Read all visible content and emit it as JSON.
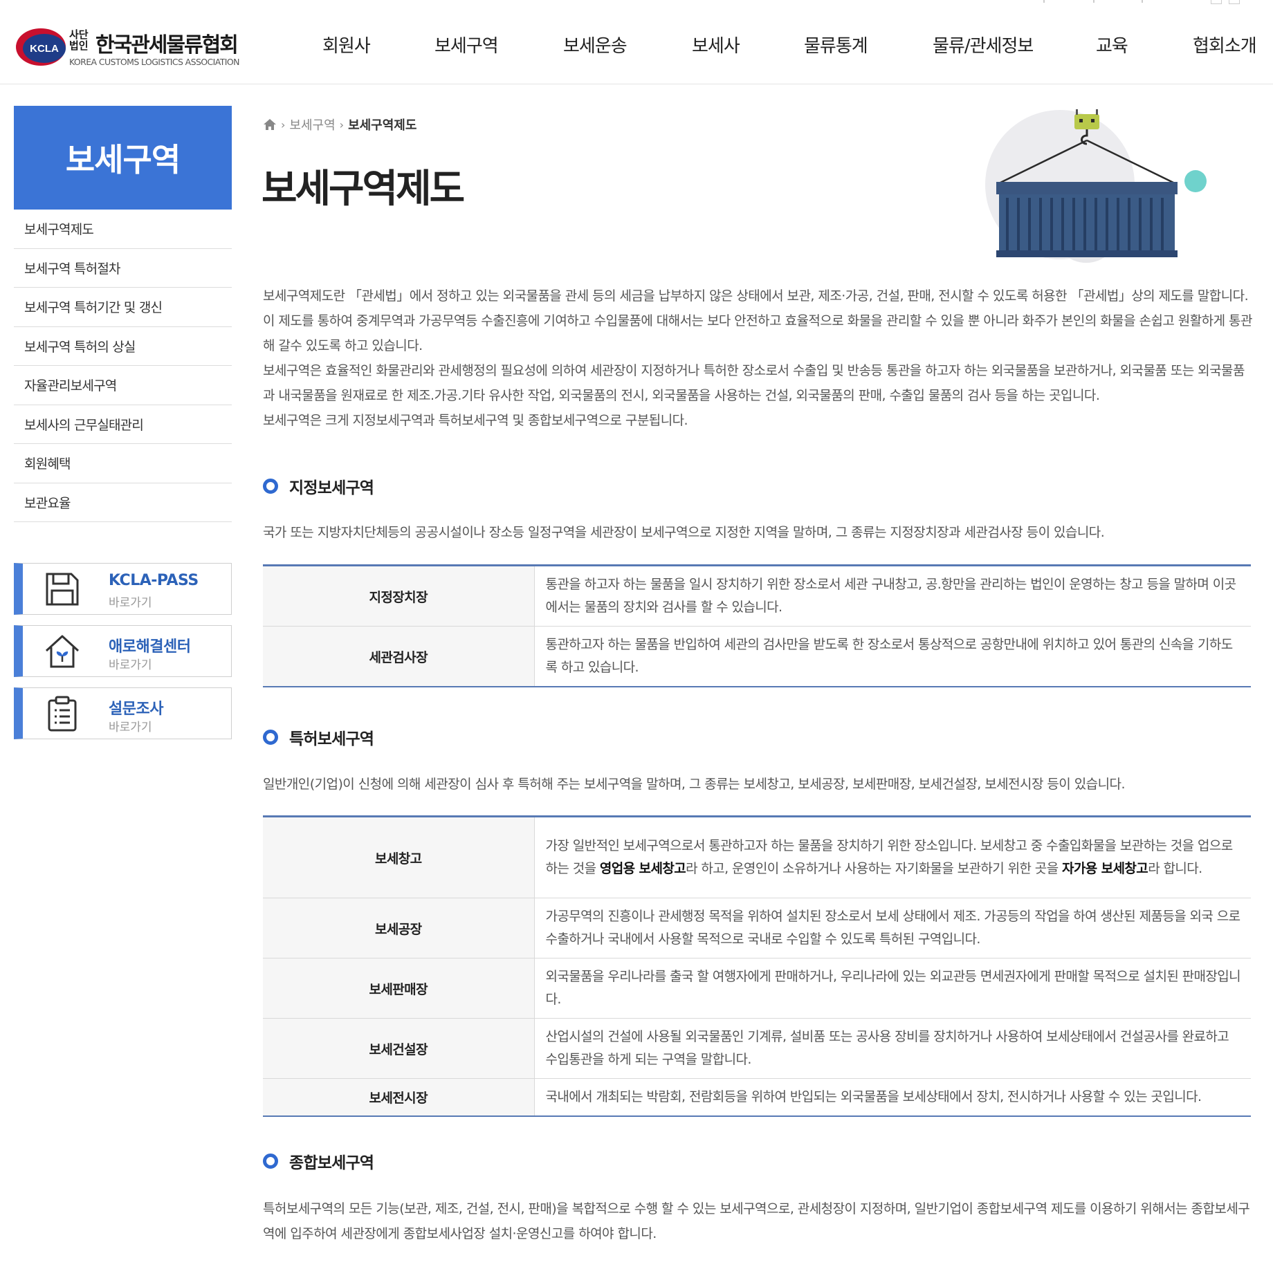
{
  "header": {
    "logo_small": "사단법인",
    "logo_name_kr": "한국관세물류협회",
    "logo_name_en": "KOREA CUSTOMS LOGISTICS ASSOCIATION",
    "logo_badge": "KCLA",
    "nav": [
      "회원사",
      "보세구역",
      "보세운송",
      "보세사",
      "물류통계",
      "물류/관세정보",
      "교육",
      "협회소개"
    ]
  },
  "sidebar": {
    "title": "보세구역",
    "items": [
      "보세구역제도",
      "보세구역 특허절차",
      "보세구역 특허기간 및 갱신",
      "보세구역 특허의 상실",
      "자율관리보세구역",
      "보세사의 근무실태관리",
      "회원혜택",
      "보관요율"
    ],
    "quick_links": [
      {
        "title": "KCLA-PASS",
        "sub": "바로가기",
        "icon": "floppy-disk-icon"
      },
      {
        "title": "애로해결센터",
        "sub": "바로가기",
        "icon": "house-sprout-icon"
      },
      {
        "title": "설문조사",
        "sub": "바로가기",
        "icon": "clipboard-icon"
      }
    ]
  },
  "breadcrumb": {
    "home_icon": "home-icon",
    "level1": "보세구역",
    "level2": "보세구역제도"
  },
  "page_title": "보세구역제도",
  "intro": [
    "보세구역제도란 「관세법」에서 정하고 있는 외국물품을 관세 등의 세금을 납부하지 않은 상태에서 보관, 제조·가공, 건설, 판매, 전시할 수 있도록 허용한 「관세법」상의 제도를 말합니다. 이 제도를 통하여 중계무역과 가공무역등 수출진흥에 기여하고 수입물품에 대해서는 보다 안전하고 효율적으로 화물을 관리할 수 있을 뿐 아니라 화주가 본인의 화물을 손쉽고 원활하게 통관해 갈수 있도록 하고 있습니다.",
    "보세구역은 효율적인 화물관리와 관세행정의 필요성에 의하여 세관장이 지정하거나 특허한 장소로서 수출입 및 반송등 통관을 하고자 하는 외국물품을 보관하거나, 외국물품 또는 외국물품과 내국물품을 원재료로 한 제조.가공.기타 유사한 작업, 외국물품의 전시, 외국물품을 사용하는 건설, 외국물품의 판매, 수출입 물품의 검사 등을 하는 곳입니다.",
    "보세구역은 크게 지정보세구역과 특허보세구역 및 종합보세구역으로 구분됩니다."
  ],
  "sections": {
    "designated": {
      "title": "지정보세구역",
      "desc": "국가 또는 지방자치단체등의 공공시설이나 장소등 일정구역을 세관장이 보세구역으로 지정한 지역을 말하며, 그 종류는 지정장치장과 세관검사장 등이 있습니다.",
      "rows": [
        {
          "name": "지정장치장",
          "text": "통관을 하고자 하는 물품을 일시 장치하기 위한 장소로서 세관 구내창고, 공.항만을 관리하는 법인이 운영하는 창고 등을 말하며 이곳에서는 물품의 장치와 검사를 할 수 있습니다."
        },
        {
          "name": "세관검사장",
          "text": "통관하고자 하는 물품을 반입하여 세관의 검사만을 받도록 한 장소로서 통상적으로 공항만내에 위치하고 있어 통관의 신속을 기하도록 하고 있습니다."
        }
      ]
    },
    "patented": {
      "title": "특허보세구역",
      "desc": "일반개인(기업)이 신청에 의해 세관장이 심사 후 특허해 주는 보세구역을 말하며, 그 종류는 보세창고, 보세공장, 보세판매장, 보세건설장, 보세전시장 등이 있습니다.",
      "warehouse": {
        "name": "보세창고",
        "text_a": "가장 일반적인 보세구역으로서 통관하고자 하는 물품을 장치하기 위한 장소입니다. 보세창고 중 수출입화물을 보관하는 것을 업으로 하는 것을 ",
        "bold_a": "영업용 보세창고",
        "text_b": "라 하고, 운영인이 소유하거나 사용하는 자기화물을 보관하기 위한 곳을 ",
        "bold_b": "자가용 보세창고",
        "text_c": "라 합니다."
      },
      "rows": [
        {
          "name": "보세공장",
          "text": "가공무역의 진흥이나 관세행정 목적을 위하여 설치된 장소로서 보세 상태에서 제조. 가공등의 작업을 하여 생산된 제품등을 외국 으로 수출하거나 국내에서 사용할 목적으로 국내로 수입할 수 있도록 특허된 구역입니다."
        },
        {
          "name": "보세판매장",
          "text": "외국물품을 우리나라를 출국 할 여행자에게 판매하거나, 우리나라에 있는 외교관등 면세권자에게 판매할 목적으로 설치된 판매장입니다."
        },
        {
          "name": "보세건설장",
          "text": "산업시설의 건설에 사용될 외국물품인 기계류, 설비품 또는 공사용 장비를 장치하거나 사용하여 보세상태에서 건설공사를 완료하고 수입통관을 하게 되는 구역을 말합니다."
        },
        {
          "name": "보세전시장",
          "text": "국내에서 개최되는 박람회, 전람회등을 위하여 반입되는 외국물품을 보세상태에서 장치, 전시하거나 사용할 수 있는 곳입니다."
        }
      ]
    },
    "integrated": {
      "title": "종합보세구역",
      "desc": "특허보세구역의 모든 기능(보관, 제조, 건설, 전시, 판매)을 복합적으로 수행 할 수 있는 보세구역으로, 관세청장이 지정하며, 일반기업이 종합보세구역 제도를 이용하기 위해서는 종합보세구역에 입주하여 세관장에게 종합보세사업장 설치·운영신고를 하여야 합니다."
    }
  },
  "colors": {
    "accent": "#3b74d6",
    "table_border": "#5779b4",
    "ring": "#2f69d0"
  }
}
